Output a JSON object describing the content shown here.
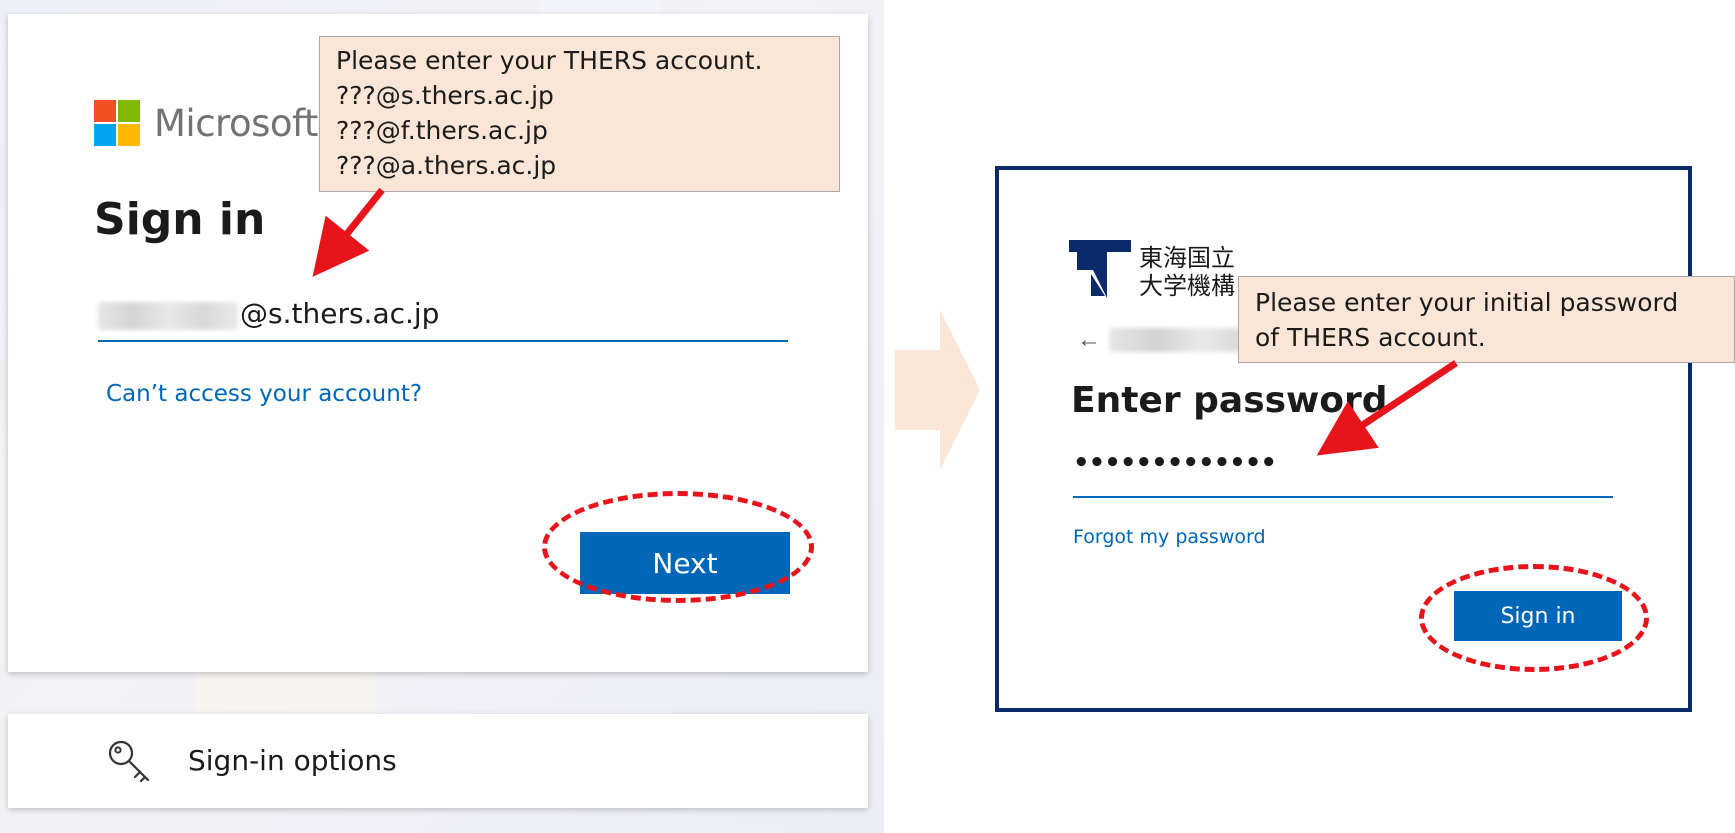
{
  "left_panel": {
    "brand_name": "Microsoft",
    "title": "Sign in",
    "email_value": "@s.thers.ac.jp",
    "cant_access_link": "Can’t access your account?",
    "next_button": "Next",
    "sign_in_options": "Sign-in options"
  },
  "callout_account": {
    "line1": "Please enter your THERS account.",
    "line2": "???@s.thers.ac.jp",
    "line3": "???@f.thers.ac.jp",
    "line4": "???@a.thers.ac.jp"
  },
  "right_panel": {
    "org_logo_line1": "東海国立",
    "org_logo_line2": "大学機構",
    "back_icon": "←",
    "title": "Enter password",
    "password_masked": "•••••••••••••",
    "forgot_link": "Forgot my password",
    "sign_in_button": "Sign in"
  },
  "callout_password": {
    "line1": "Please enter your initial password",
    "line2": "of THERS account."
  },
  "icons": {
    "key": "key-icon",
    "back": "back-arrow-icon",
    "annotation_arrow": "red-arrow-icon",
    "flow_arrow": "flow-arrow-icon"
  },
  "colors": {
    "accent_blue": "#0067b8",
    "callout_fill": "#fbe5d6",
    "annotation_red": "#e8141b",
    "thers_navy": "#0a2a6b"
  }
}
